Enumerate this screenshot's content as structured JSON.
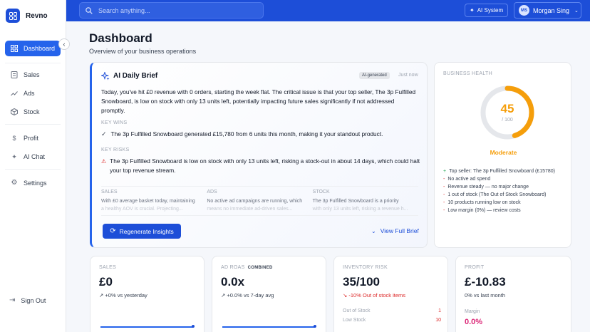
{
  "brand": {
    "name": "Revno"
  },
  "sidebar": {
    "items": [
      {
        "label": "Dashboard",
        "icon": "grid-icon",
        "active": true
      },
      {
        "label": "Sales",
        "icon": "receipt-icon"
      },
      {
        "label": "Ads",
        "icon": "trending-up-icon"
      },
      {
        "label": "Stock",
        "icon": "box-icon"
      },
      {
        "label": "Profit",
        "icon": "dollar-icon"
      },
      {
        "label": "AI Chat",
        "icon": "sparkle-icon"
      },
      {
        "label": "Settings",
        "icon": "gear-icon"
      }
    ],
    "sign_out": "Sign Out"
  },
  "header": {
    "search_placeholder": "Search anything...",
    "ai_system": "AI System",
    "user_initials": "MS",
    "user_name": "Morgan Sing"
  },
  "page": {
    "title": "Dashboard",
    "subtitle": "Overview of your business operations"
  },
  "brief": {
    "title": "AI Daily Brief",
    "badge": "AI-generated",
    "time": "Just now",
    "summary": "Today, you've hit £0 revenue with 0 orders, starting the week flat. The critical issue is that your top seller, The 3p Fulfilled Snowboard, is low on stock with only 13 units left, potentially impacting future sales significantly if not addressed promptly.",
    "wins_label": "KEY WINS",
    "win": "The 3p Fulfilled Snowboard generated £15,780 from 6 units this month, making it your standout product.",
    "risks_label": "KEY RISKS",
    "risk": "The 3p Fulfilled Snowboard is low on stock with only 13 units left, risking a stock-out in about 14 days, which could halt your top revenue stream.",
    "columns": [
      {
        "head": "SALES",
        "text1": "With £0 average basket today, maintaining",
        "text2": "a healthy AOV is crucial. Projecting..."
      },
      {
        "head": "ADS",
        "text1": "No active ad campaigns are running, which",
        "text2": "means no immediate ad-driven sales..."
      },
      {
        "head": "STOCK",
        "text1": "The 3p Fulfilled Snowboard is a priority",
        "text2": "with only 13 units left, risking a revenue h..."
      }
    ],
    "regenerate": "Regenerate Insights",
    "view_full": "View Full Brief"
  },
  "health": {
    "label": "BUSINESS HEALTH",
    "score": "45",
    "max": "/ 100",
    "score_fraction": 0.45,
    "status": "Moderate",
    "items": [
      {
        "mark": "+",
        "text": "Top seller: The 3p Fulfilled Snowboard (£15780)"
      },
      {
        "mark": "-",
        "text": "No active ad spend"
      },
      {
        "mark": "-",
        "text": "Revenue steady — no major change"
      },
      {
        "mark": "-",
        "text": "1 out of stock (The Out of Stock Snowboard)"
      },
      {
        "mark": "-",
        "text": "10 products running low on stock"
      },
      {
        "mark": "-",
        "text": "Low margin (0%) — review costs"
      }
    ]
  },
  "stats": {
    "sales": {
      "label": "SALES",
      "value": "£0",
      "delta": "+0% vs yesterday"
    },
    "ads": {
      "label": "AD ROAS",
      "tag": "COMBINED",
      "value": "0.0x",
      "delta": "+0.0% vs 7-day avg"
    },
    "inventory": {
      "label": "INVENTORY RISK",
      "value": "35/100",
      "delta": "-10% Out of stock items",
      "rows": [
        {
          "label": "Out of Stock",
          "num": "1"
        },
        {
          "label": "Low Stock",
          "num": "10"
        }
      ]
    },
    "profit": {
      "label": "PROFIT",
      "value": "£-10.83",
      "delta": "0% vs last month",
      "margin_label": "Margin",
      "margin_value": "0.0%"
    }
  },
  "colors": {
    "accent": "#1d4ed8",
    "warning": "#f59e0b",
    "danger": "#dc2626",
    "success": "#16a34a"
  }
}
